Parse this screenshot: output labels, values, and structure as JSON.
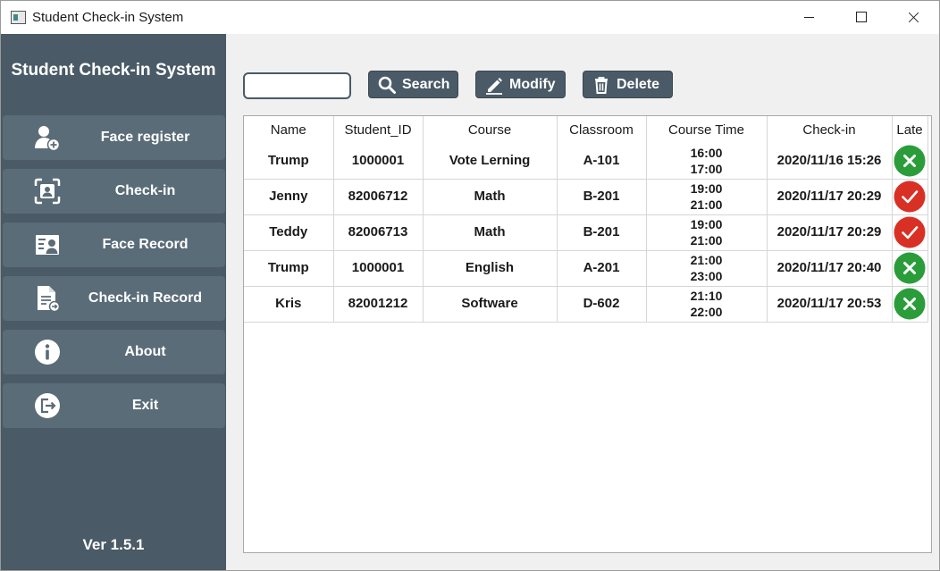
{
  "window": {
    "title": "Student Check-in System"
  },
  "sidebar": {
    "app_title": "Student Check-in System",
    "items": [
      {
        "label": "Face register",
        "icon": "face-register-icon"
      },
      {
        "label": "Check-in",
        "icon": "face-scan-icon"
      },
      {
        "label": "Face Record",
        "icon": "face-record-icon"
      },
      {
        "label": "Check-in Record",
        "icon": "record-document-icon"
      },
      {
        "label": "About",
        "icon": "info-icon"
      },
      {
        "label": "Exit",
        "icon": "exit-icon"
      }
    ],
    "version": "Ver 1.5.1"
  },
  "toolbar": {
    "search_value": "",
    "search_label": "Search",
    "modify_label": "Modify",
    "delete_label": "Delete"
  },
  "table": {
    "columns": [
      "Name",
      "Student_ID",
      "Course",
      "Classroom",
      "Course Time",
      "Check-in",
      "Late"
    ],
    "rows": [
      {
        "name": "Trump",
        "student_id": "1000001",
        "course": "Vote Lerning",
        "classroom": "A-101",
        "time_start": "16:00",
        "time_end": "17:00",
        "checkin": "2020/11/16 15:26",
        "late": false
      },
      {
        "name": "Jenny",
        "student_id": "82006712",
        "course": "Math",
        "classroom": "B-201",
        "time_start": "19:00",
        "time_end": "21:00",
        "checkin": "2020/11/17 20:29",
        "late": true
      },
      {
        "name": "Teddy",
        "student_id": "82006713",
        "course": "Math",
        "classroom": "B-201",
        "time_start": "19:00",
        "time_end": "21:00",
        "checkin": "2020/11/17 20:29",
        "late": true
      },
      {
        "name": "Trump",
        "student_id": "1000001",
        "course": "English",
        "classroom": "A-201",
        "time_start": "21:00",
        "time_end": "23:00",
        "checkin": "2020/11/17 20:40",
        "late": false
      },
      {
        "name": "Kris",
        "student_id": "82001212",
        "course": "Software",
        "classroom": "D-602",
        "time_start": "21:10",
        "time_end": "22:00",
        "checkin": "2020/11/17 20:53",
        "late": false
      }
    ]
  },
  "colors": {
    "sidebar_bg": "#4a5a66",
    "nav_item_bg": "#5a6c78",
    "late_true": "#d93025",
    "late_false": "#2a9d3a"
  }
}
